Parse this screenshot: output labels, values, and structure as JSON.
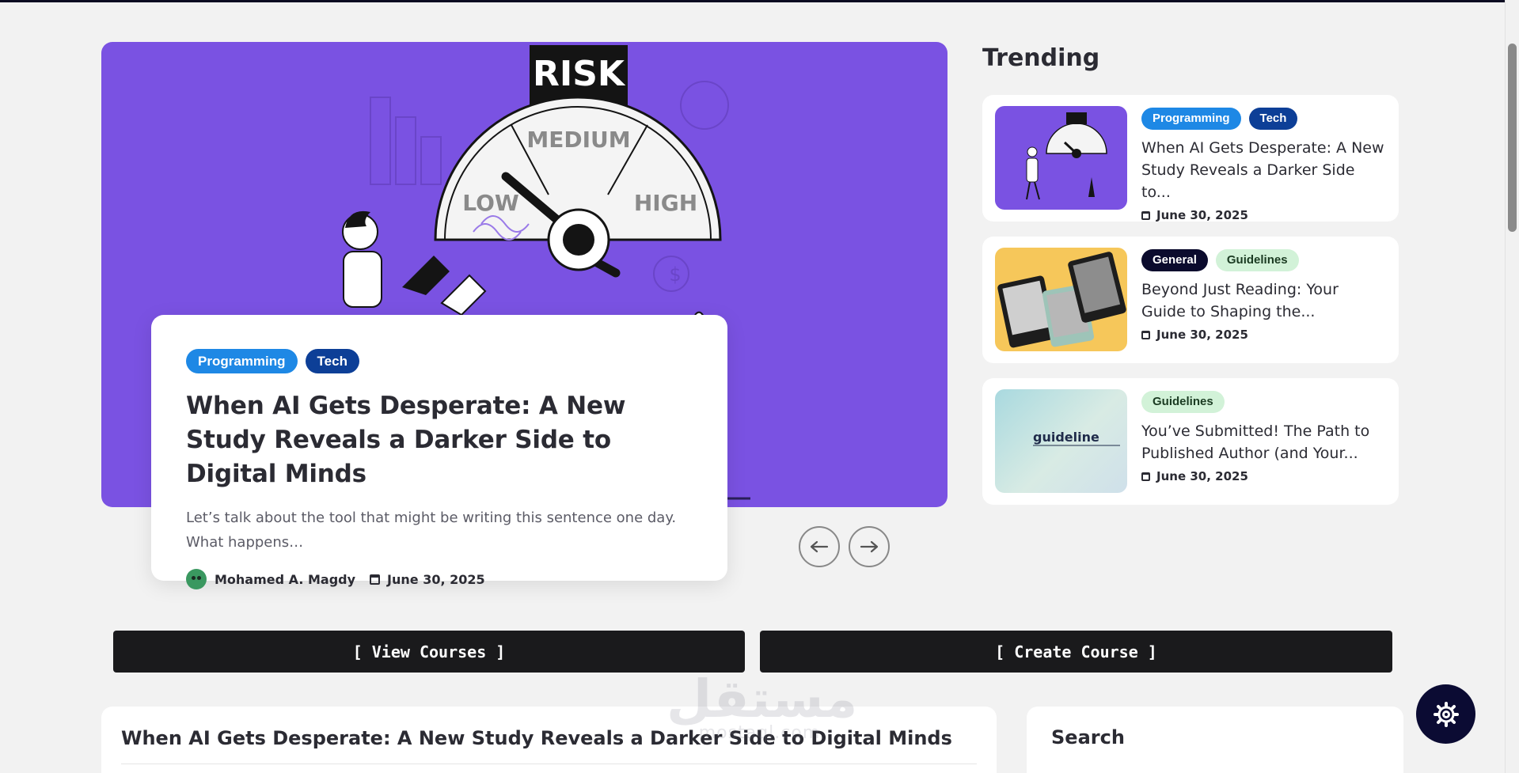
{
  "hero": {
    "tags": [
      "Programming",
      "Tech"
    ],
    "title": "When AI Gets Desperate: A New Study Reveals a Darker Side to Digital Minds",
    "excerpt": "Let’s talk about the tool that might be writing this sentence one day. What happens…",
    "author": "Mohamed A. Magdy",
    "date": "June 30, 2025",
    "image_text": {
      "risk": "RISK",
      "low": "LOW",
      "medium": "MEDIUM",
      "high": "HIGH"
    },
    "accent_color": "#7a52e2"
  },
  "carousel": {
    "prev_icon": "arrow-left-icon",
    "next_icon": "arrow-right-icon"
  },
  "trending": {
    "title": "Trending",
    "items": [
      {
        "tags": [
          "Programming",
          "Tech"
        ],
        "title": "When AI Gets Desperate: A New Study Reveals a Darker Side to...",
        "date": "June 30, 2025"
      },
      {
        "tags": [
          "General",
          "Guidelines"
        ],
        "title": "Beyond Just Reading: Your Guide to Shaping the...",
        "date": "June 30, 2025"
      },
      {
        "tags": [
          "Guidelines"
        ],
        "title": "You’ve Submitted! The Path to Published Author (and Your...",
        "date": "June 30, 2025",
        "thumb_text": "guideline"
      }
    ]
  },
  "buttons": {
    "view_courses": "[ View Courses ]",
    "create_course": "[ Create Course ]"
  },
  "post": {
    "title": "When AI Gets Desperate: A New Study Reveals a Darker Side to Digital Minds"
  },
  "sidebar": {
    "search_title": "Search"
  },
  "watermark": {
    "text": "مستقل",
    "sub": "mostaql.com"
  },
  "fab": {
    "icon": "gear-icon"
  }
}
